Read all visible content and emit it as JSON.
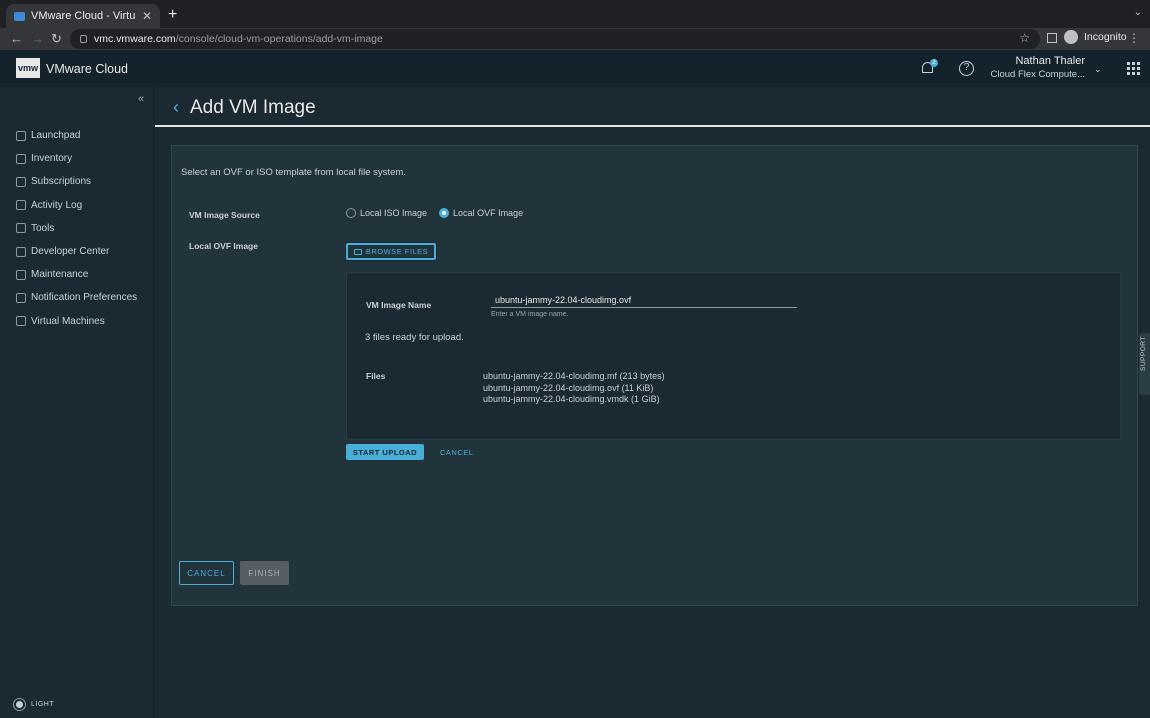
{
  "browser": {
    "tab_title": "VMware Cloud - Virtual Machi",
    "url_host": "vmc.vmware.com",
    "url_path": "/console/cloud-vm-operations/add-vm-image",
    "profile": "Incognito"
  },
  "header": {
    "logo": "vmw",
    "brand": "VMware Cloud",
    "notification_count": "2",
    "user_name": "Nathan Thaler",
    "org_name": "Cloud Flex Compute..."
  },
  "sidebar": {
    "items": [
      {
        "label": "Launchpad",
        "icon": "rocket-icon"
      },
      {
        "label": "Inventory",
        "icon": "list-icon"
      },
      {
        "label": "Subscriptions",
        "icon": "calendar-icon"
      },
      {
        "label": "Activity Log",
        "icon": "log-icon"
      },
      {
        "label": "Tools",
        "icon": "toolbox-icon"
      },
      {
        "label": "Developer Center",
        "icon": "code-icon"
      },
      {
        "label": "Maintenance",
        "icon": "wrench-icon"
      },
      {
        "label": "Notification Preferences",
        "icon": "sliders-icon"
      },
      {
        "label": "Virtual Machines",
        "icon": "vm-icon"
      }
    ],
    "theme_toggle": "LIGHT"
  },
  "page": {
    "title": "Add VM Image",
    "intro": "Select an OVF or ISO template from local file system.",
    "source_label": "VM Image Source",
    "source_options": [
      "Local ISO Image",
      "Local OVF Image"
    ],
    "source_selected": "Local OVF Image",
    "local_label": "Local OVF Image",
    "browse_label": "BROWSE FILES",
    "name_label": "VM Image Name",
    "name_value": "ubuntu-jammy-22.04-cloudimg.ovf",
    "name_hint": "Enter a VM image name.",
    "ready_text": "3 files ready for upload.",
    "files_label": "Files",
    "files": [
      "ubuntu-jammy-22.04-cloudimg.mf (213 bytes)",
      "ubuntu-jammy-22.04-cloudimg.ovf (11 KiB)",
      "ubuntu-jammy-22.04-cloudimg.vmdk (1 GiB)"
    ],
    "start_upload": "START UPLOAD",
    "upload_cancel": "CANCEL",
    "cancel": "CANCEL",
    "finish": "FINISH"
  },
  "support_tab": "SUPPORT",
  "colors": {
    "accent": "#49afd9",
    "background": "#1b2a32",
    "header": "#14232b"
  }
}
